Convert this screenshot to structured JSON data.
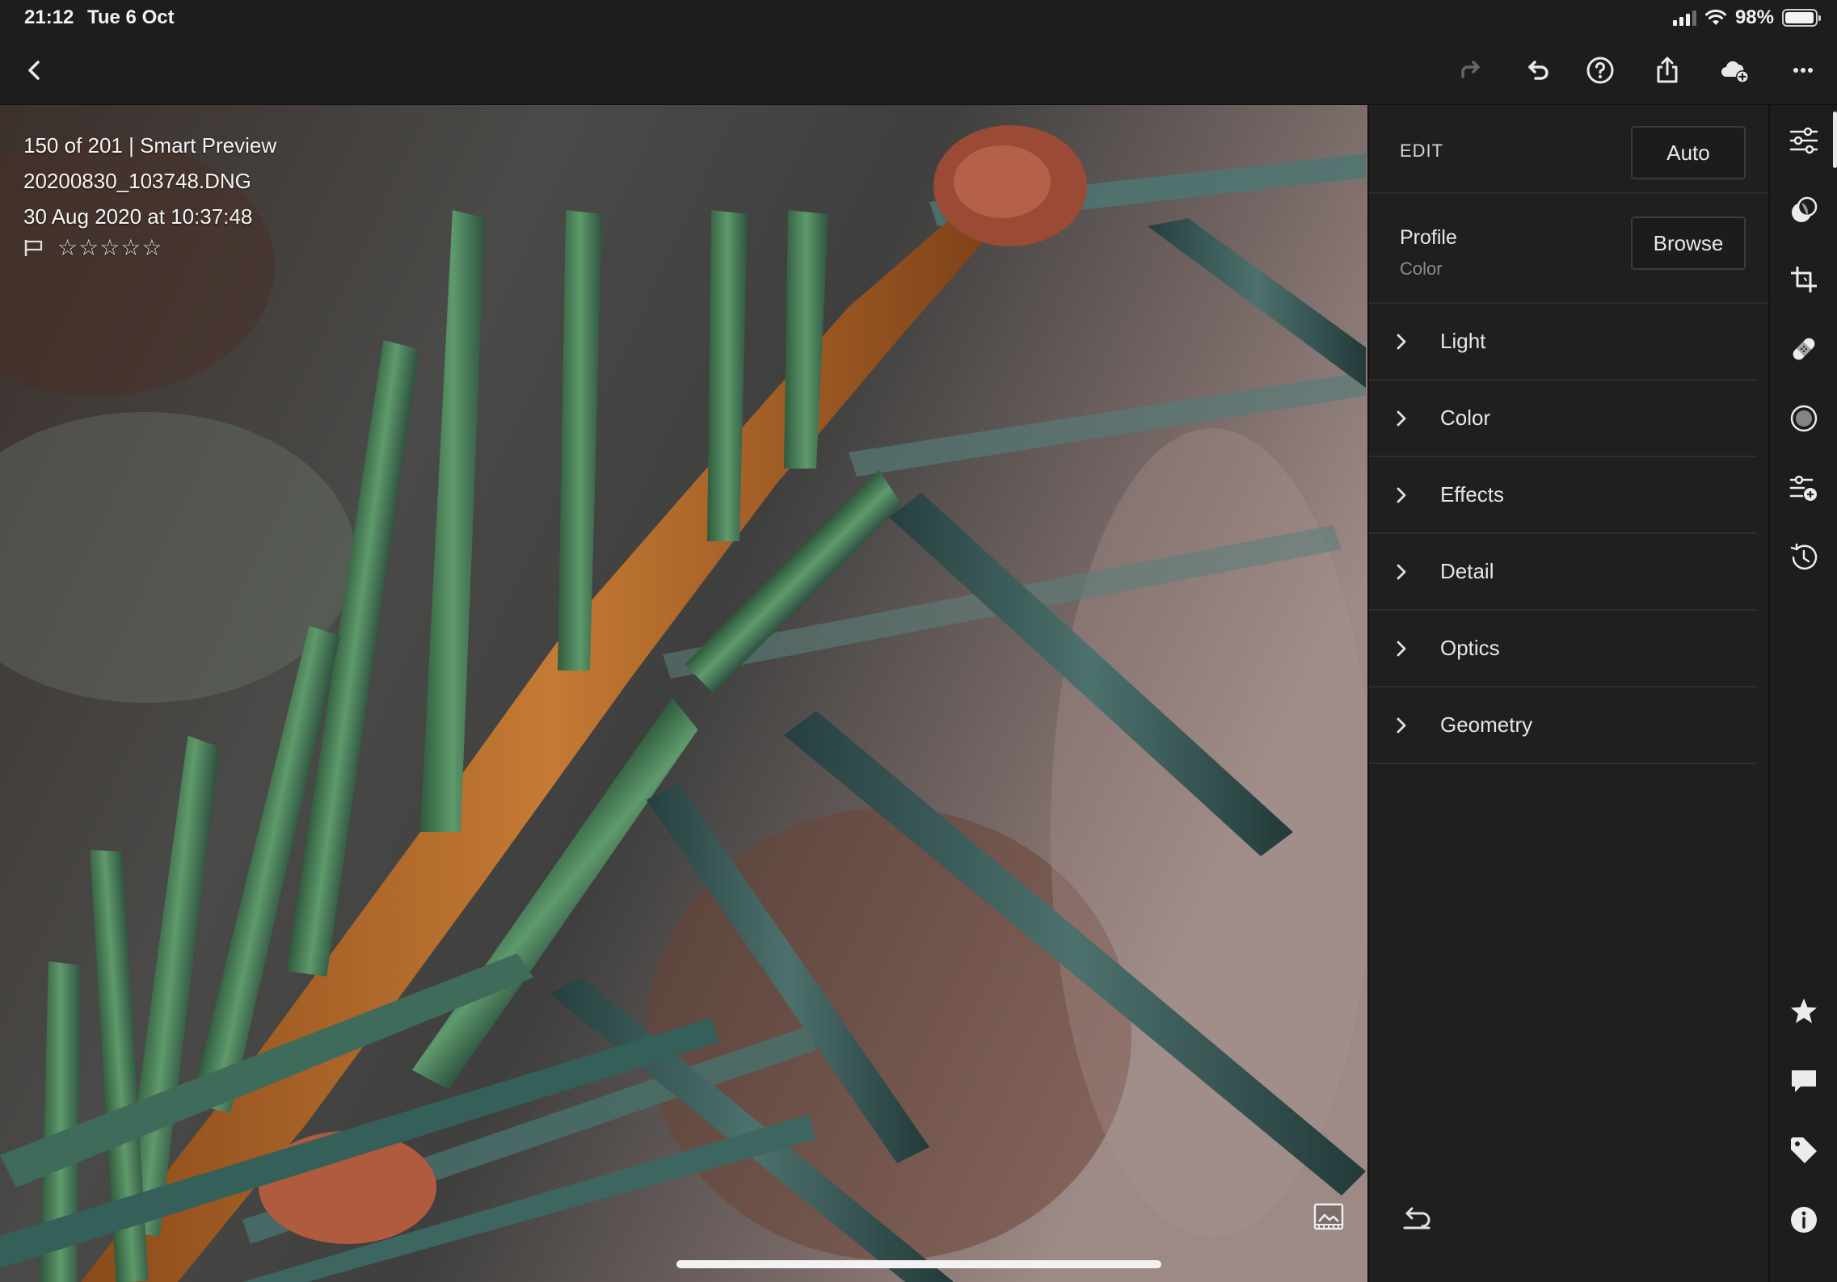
{
  "status_bar": {
    "time": "21:12",
    "date": "Tue 6 Oct",
    "battery_pct": "98%",
    "battery_level": 0.98,
    "icons": [
      "cellular-signal-icon",
      "wifi-icon",
      "battery-icon"
    ]
  },
  "toolbar": {
    "icons": [
      "back-chevron-icon",
      "redo-icon",
      "undo-icon",
      "help-icon",
      "share-icon",
      "cloud-add-icon",
      "more-icon"
    ]
  },
  "photo": {
    "info_line1": "150 of 201 | Smart Preview",
    "info_line2": "20200830_103748.DNG",
    "info_line3": "30 Aug 2020 at 10:37:48",
    "stars": "☆☆☆☆☆",
    "rating": 0,
    "icons": [
      "flag-icon",
      "compare-icon"
    ]
  },
  "edit_panel": {
    "header_label": "EDIT",
    "auto_label": "Auto",
    "profile_title": "Profile",
    "profile_value": "Color",
    "browse_label": "Browse",
    "sections": [
      {
        "label": "Light"
      },
      {
        "label": "Color"
      },
      {
        "label": "Effects"
      },
      {
        "label": "Detail"
      },
      {
        "label": "Optics"
      },
      {
        "label": "Geometry"
      }
    ],
    "icons": [
      "reset-icon"
    ]
  },
  "rail": {
    "icons": [
      "edit-sliders-icon",
      "presets-icon",
      "crop-icon",
      "healing-icon",
      "masking-icon",
      "versions-icon",
      "history-icon",
      "rate-star-icon",
      "comment-icon",
      "keyword-tag-icon",
      "info-icon"
    ]
  },
  "colors": {
    "background": "#1c1c1c",
    "panel": "#1f1f1f",
    "divider": "#2e2e2e",
    "text": "#e6e6e6",
    "muted_text": "#8c8c8c"
  }
}
